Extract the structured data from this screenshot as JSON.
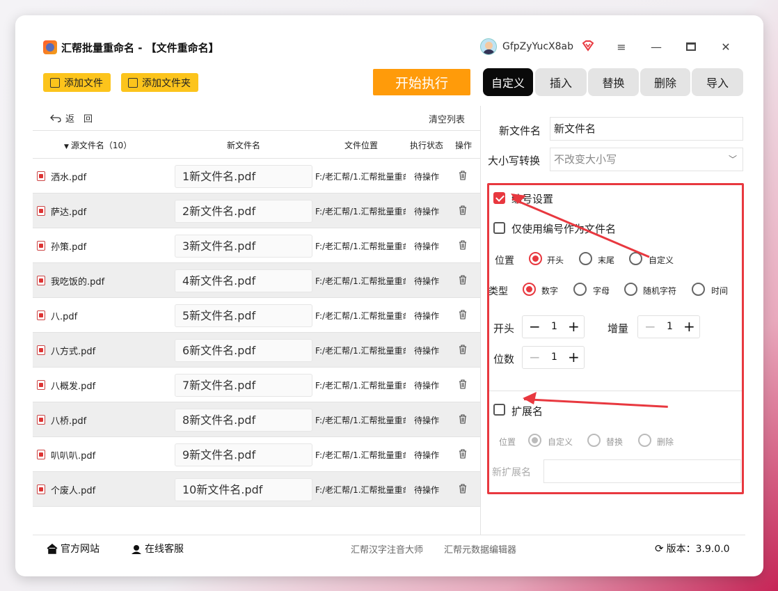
{
  "app": {
    "title": "汇帮批量重命名 - 【文件重命名】",
    "username": "GfpZyYucX8ab"
  },
  "toolbar": {
    "add_file": "添加文件",
    "add_folder": "添加文件夹",
    "start": "开始执行"
  },
  "tabs": [
    "自定义",
    "插入",
    "替换",
    "删除",
    "导入"
  ],
  "list": {
    "back": "返　回",
    "clear": "清空列表",
    "headers": {
      "source": "源文件名（10）",
      "new_name": "新文件名",
      "location": "文件位置",
      "status": "执行状态",
      "action": "操作"
    },
    "rows": [
      {
        "src": "洒水.pdf",
        "new": "1新文件名.pdf",
        "loc": "F:/老汇帮/1.汇帮批量重命",
        "status": "待操作"
      },
      {
        "src": "萨达.pdf",
        "new": "2新文件名.pdf",
        "loc": "F:/老汇帮/1.汇帮批量重命",
        "status": "待操作"
      },
      {
        "src": "孙策.pdf",
        "new": "3新文件名.pdf",
        "loc": "F:/老汇帮/1.汇帮批量重命",
        "status": "待操作"
      },
      {
        "src": "我吃饭的.pdf",
        "new": "4新文件名.pdf",
        "loc": "F:/老汇帮/1.汇帮批量重命",
        "status": "待操作"
      },
      {
        "src": "八.pdf",
        "new": "5新文件名.pdf",
        "loc": "F:/老汇帮/1.汇帮批量重命",
        "status": "待操作"
      },
      {
        "src": "八方式.pdf",
        "new": "6新文件名.pdf",
        "loc": "F:/老汇帮/1.汇帮批量重命",
        "status": "待操作"
      },
      {
        "src": "八概发.pdf",
        "new": "7新文件名.pdf",
        "loc": "F:/老汇帮/1.汇帮批量重命",
        "status": "待操作"
      },
      {
        "src": "八桥.pdf",
        "new": "8新文件名.pdf",
        "loc": "F:/老汇帮/1.汇帮批量重命",
        "status": "待操作"
      },
      {
        "src": "叭叭叭.pdf",
        "new": "9新文件名.pdf",
        "loc": "F:/老汇帮/1.汇帮批量重命",
        "status": "待操作"
      },
      {
        "src": "个废人.pdf",
        "new": "10新文件名.pdf",
        "loc": "F:/老汇帮/1.汇帮批量重命",
        "status": "待操作"
      }
    ]
  },
  "panel": {
    "new_name_label": "新文件名",
    "new_name_value": "新文件名",
    "case_label": "大小写转换",
    "case_value": "不改变大小写",
    "numbering_label": "编号设置",
    "numbering_checked": true,
    "only_number_label": "仅使用编号作为文件名",
    "position_label": "位置",
    "position_options": [
      "开头",
      "末尾",
      "自定义"
    ],
    "position_selected": "开头",
    "type_label": "类型",
    "type_options": [
      "数字",
      "字母",
      "随机字符",
      "时间"
    ],
    "type_selected": "数字",
    "start_label": "开头",
    "start_value": "1",
    "increment_label": "增量",
    "increment_value": "1",
    "digits_label": "位数",
    "digits_value": "1",
    "ext_label": "扩展名",
    "ext_position_label": "位置",
    "ext_options": [
      "自定义",
      "替换",
      "删除"
    ],
    "ext_selected": "自定义",
    "new_ext_label": "新扩展名",
    "new_ext_value": ""
  },
  "footer": {
    "website": "官方网站",
    "support": "在线客服",
    "link1": "汇帮汉字注音大师",
    "link2": "汇帮元数据编辑器",
    "version": "版本：3.9.0.0"
  },
  "colors": {
    "accent_red": "#e8383f",
    "toolbar_yellow": "#fcc41c",
    "start_orange": "#ff9b0a"
  }
}
